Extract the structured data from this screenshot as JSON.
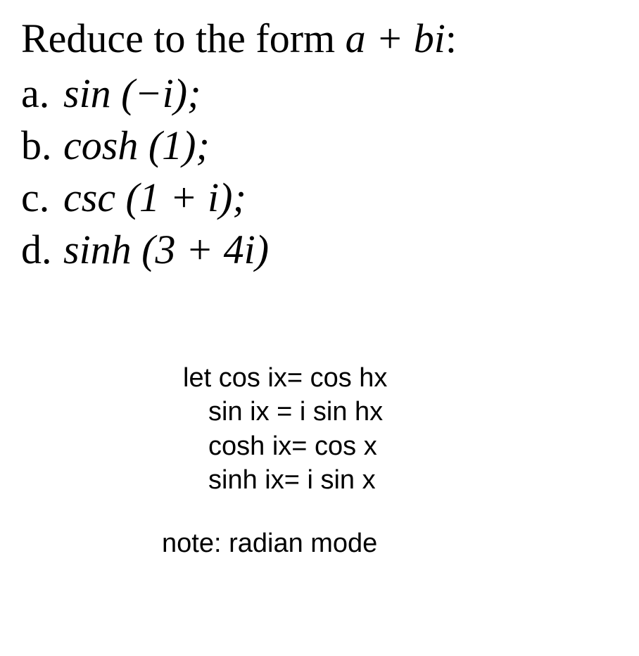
{
  "title": {
    "prefix": "Reduce to the form ",
    "expr": "a +  bi",
    "suffix": ":"
  },
  "problems": {
    "a": {
      "label": "a.  ",
      "expr": "sin (−i);"
    },
    "b": {
      "label": "b.  ",
      "expr": "cosh (1);"
    },
    "c": {
      "label": "c.  ",
      "expr": "csc  (1 + i);"
    },
    "d": {
      "label": "d.  ",
      "expr": "sinh (3 + 4i)"
    }
  },
  "hints": {
    "line1": "let cos ix= cos hx",
    "line2": "sin ix = i sin hx",
    "line3": "cosh ix= cos x",
    "line4": "sinh ix= i sin x"
  },
  "note": "note: radian mode"
}
